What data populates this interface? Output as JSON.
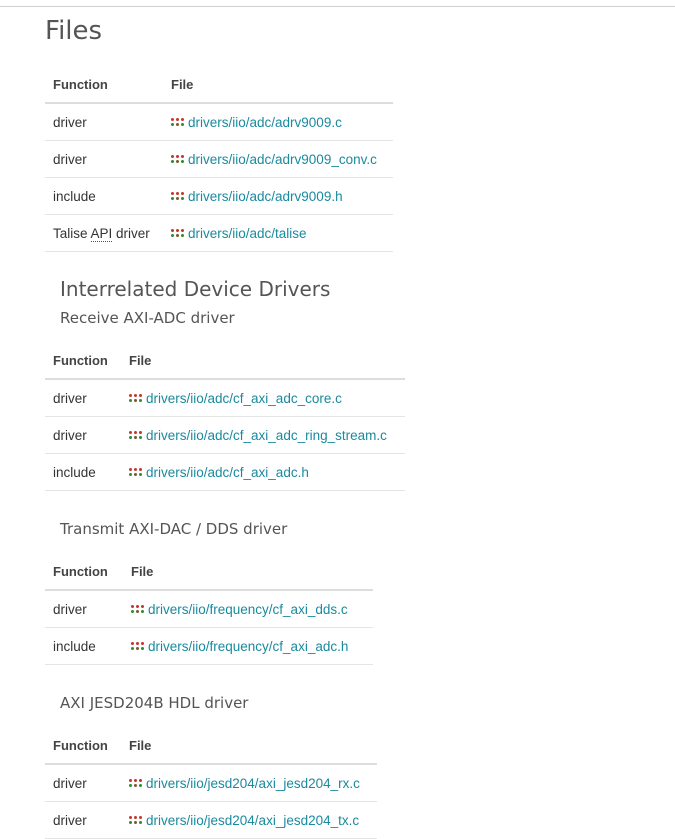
{
  "page": {
    "title": "Files",
    "function_header": "Function",
    "file_header": "File"
  },
  "files": {
    "rows": [
      {
        "function": "driver",
        "file": "drivers/iio/adc/adrv9009.c"
      },
      {
        "function": "driver",
        "file": "drivers/iio/adc/adrv9009_conv.c"
      },
      {
        "function": "include",
        "file": "drivers/iio/adc/adrv9009.h"
      },
      {
        "function_prefix": "Talise ",
        "function_abbr": "API",
        "function_suffix": " driver",
        "file": "drivers/iio/adc/talise"
      }
    ]
  },
  "interrelated": {
    "title": "Interrelated Device Drivers",
    "rx": {
      "title": "Receive AXI-ADC driver",
      "rows": [
        {
          "function": "driver",
          "file": "drivers/iio/adc/cf_axi_adc_core.c"
        },
        {
          "function": "driver",
          "file": "drivers/iio/adc/cf_axi_adc_ring_stream.c"
        },
        {
          "function": "include",
          "file": "drivers/iio/adc/cf_axi_adc.h"
        }
      ]
    },
    "tx": {
      "title": "Transmit AXI-DAC / DDS driver",
      "rows": [
        {
          "function": "driver",
          "file": "drivers/iio/frequency/cf_axi_dds.c"
        },
        {
          "function": "include",
          "file": "drivers/iio/frequency/cf_axi_adc.h"
        }
      ]
    },
    "jesd": {
      "title": "AXI JESD204B HDL driver",
      "rows": [
        {
          "function": "driver",
          "file": "drivers/iio/jesd204/axi_jesd204_rx.c"
        },
        {
          "function": "driver",
          "file": "drivers/iio/jesd204/axi_jesd204_tx.c"
        }
      ]
    }
  },
  "colors": {
    "link": "#1a8a9e",
    "icon_red": "#c0392b",
    "icon_green": "#2e8b2e",
    "icon_dark": "#7a5a2a"
  }
}
